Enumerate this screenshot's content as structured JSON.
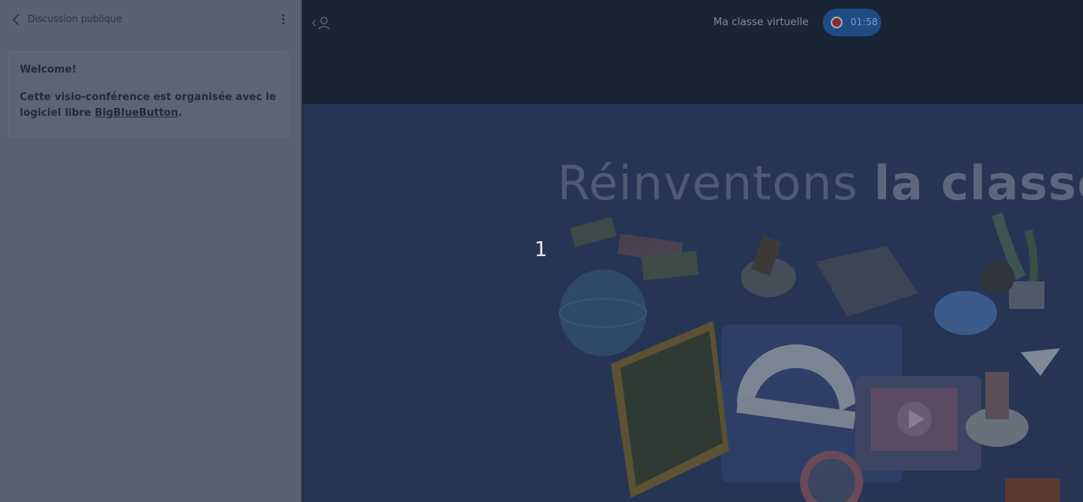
{
  "chat": {
    "title": "Discussion publique",
    "welcome_title": "Welcome!",
    "welcome_text": "Cette visio-conférence est organisée avec le logiciel libre ",
    "welcome_link": "BigBlueButton",
    "welcome_end": "."
  },
  "navbar": {
    "meeting_title": "Ma classe virtuelle",
    "recording_time": "01:58"
  },
  "slide": {
    "number": "1",
    "title_light": "Réinventons",
    "title_bold": "la classe"
  },
  "colors": {
    "record_pill": "#1f4b85",
    "record_dot": "#8a2b2b"
  }
}
